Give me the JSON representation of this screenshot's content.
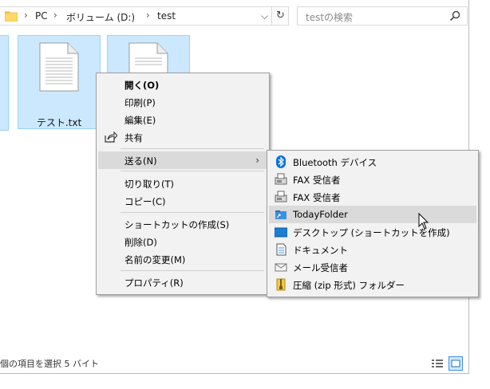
{
  "explorer": {
    "breadcrumb": [
      "PC",
      "ボリューム (D:)",
      "test"
    ],
    "search_placeholder": "testの検索",
    "files": [
      {
        "name": "テスト.txt"
      },
      {
        "name": ""
      }
    ],
    "status_text": "個の項目を選択  5 バイト"
  },
  "context_menu": {
    "items": [
      {
        "label": "開く(O)"
      },
      {
        "label": "印刷(P)"
      },
      {
        "label": "編集(E)"
      },
      {
        "label": "共有"
      },
      {
        "label": "送る(N)"
      },
      {
        "label": "切り取り(T)"
      },
      {
        "label": "コピー(C)"
      },
      {
        "label": "ショートカットの作成(S)"
      },
      {
        "label": "削除(D)"
      },
      {
        "label": "名前の変更(M)"
      },
      {
        "label": "プロパティ(R)"
      }
    ]
  },
  "send_to_menu": {
    "items": [
      {
        "label": "Bluetooth デバイス",
        "icon": "bluetooth-icon"
      },
      {
        "label": "FAX 受信者",
        "icon": "fax-icon"
      },
      {
        "label": "FAX 受信者",
        "icon": "fax-icon"
      },
      {
        "label": "TodayFolder",
        "icon": "folder-shortcut-icon"
      },
      {
        "label": "デスクトップ (ショートカットを作成)",
        "icon": "desktop-icon"
      },
      {
        "label": "ドキュメント",
        "icon": "document-icon"
      },
      {
        "label": "メール受信者",
        "icon": "mail-icon"
      },
      {
        "label": "圧縮 (zip 形式) フォルダー",
        "icon": "zip-folder-icon"
      }
    ],
    "hovered": "TodayFolder"
  },
  "colors": {
    "selection_fill": "#cce8ff",
    "selection_border": "#99d1ff",
    "menu_bg": "#f2f2f2",
    "menu_hover": "#dadada",
    "bluetooth_blue": "#0a74da"
  }
}
